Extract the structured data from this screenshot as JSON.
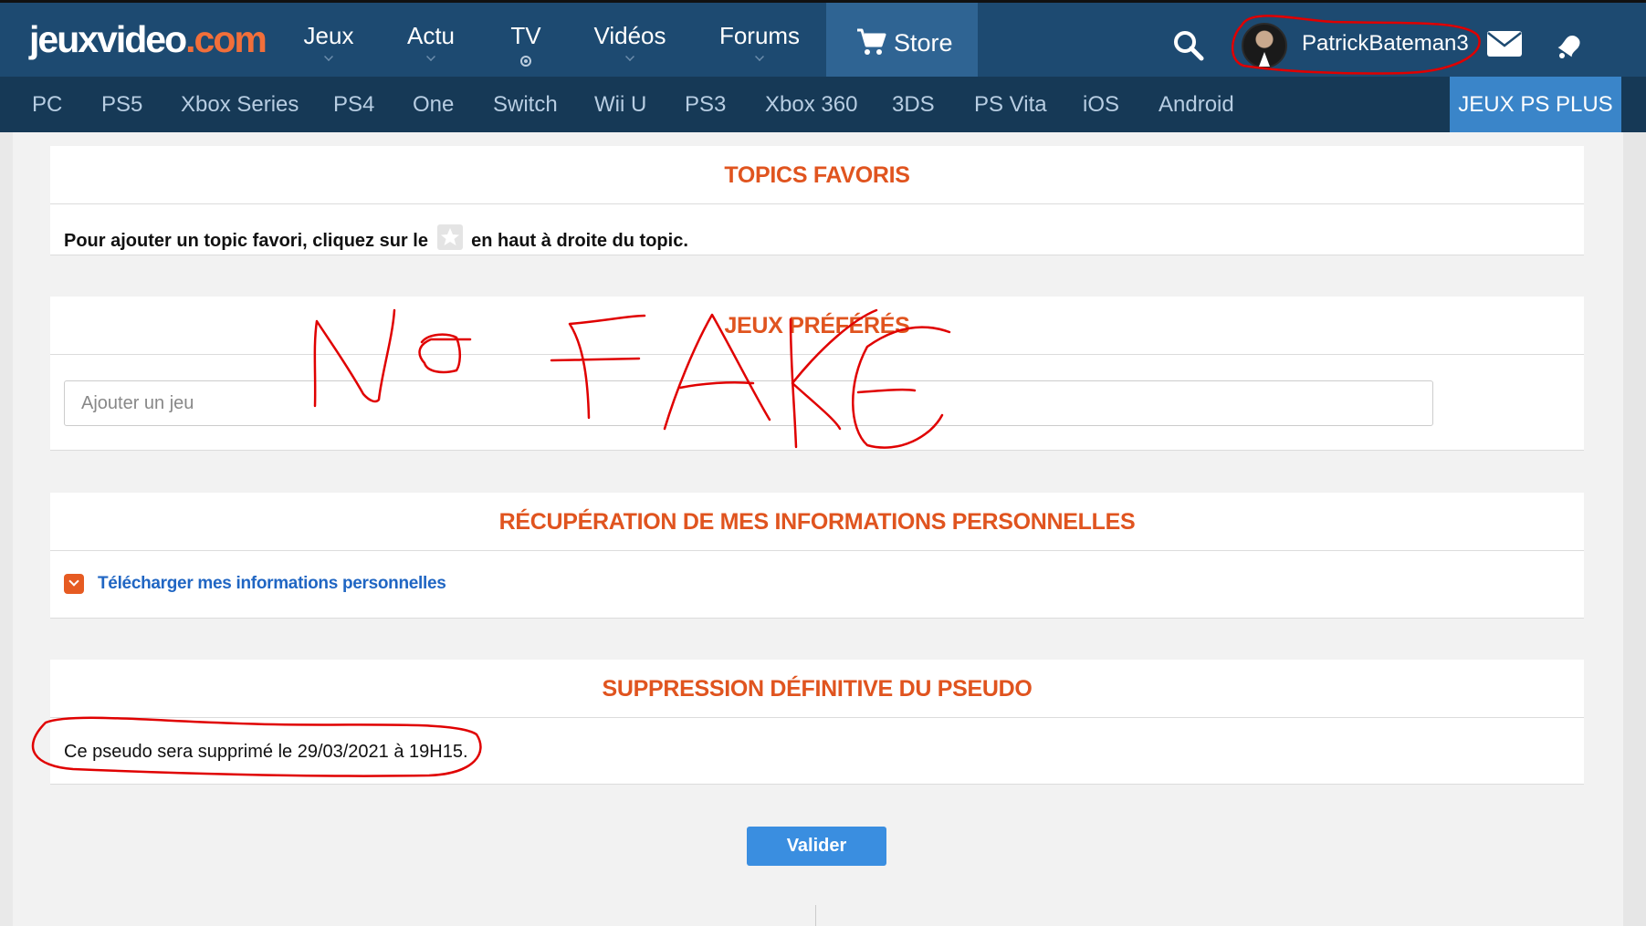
{
  "header": {
    "logo_part1": "jeuxvideo",
    "logo_part2": ".com",
    "nav": [
      {
        "label": "Jeux"
      },
      {
        "label": "Actu"
      },
      {
        "label": "TV"
      },
      {
        "label": "Vidéos"
      },
      {
        "label": "Forums"
      }
    ],
    "store_label": "Store",
    "username": "PatrickBateman3",
    "icons": [
      "cart-icon",
      "search-icon",
      "mail-icon",
      "notification-icon"
    ]
  },
  "platforms": [
    "PC",
    "PS5",
    "Xbox Series",
    "PS4",
    "One",
    "Switch",
    "Wii U",
    "PS3",
    "Xbox 360",
    "3DS",
    "PS Vita",
    "iOS",
    "Android"
  ],
  "psplus_label": "JEUX PS PLUS",
  "favorites": {
    "title": "TOPICS FAVORIS",
    "text_before": "Pour ajouter un topic favori, cliquez sur le",
    "text_after": "en haut à droite du topic."
  },
  "preferred_games": {
    "title": "JEUX PRÉFÉRÉS",
    "input_placeholder": "Ajouter un jeu",
    "input_value": ""
  },
  "personal_data": {
    "title": "RÉCUPÉRATION DE MES INFORMATIONS PERSONNELLES",
    "download_link": "Télécharger mes informations personnelles"
  },
  "deletion": {
    "title": "SUPPRESSION DÉFINITIVE DU PSEUDO",
    "text": "Ce pseudo sera supprimé le 29/03/2021 à 19H15."
  },
  "submit_label": "Valider",
  "colors": {
    "header_bg": "#1d4a71",
    "platform_bg": "#163956",
    "accent_orange": "#e0541f",
    "link_blue": "#2066c3",
    "button_blue": "#3a8ee0",
    "annotation_red": "#e00000"
  }
}
